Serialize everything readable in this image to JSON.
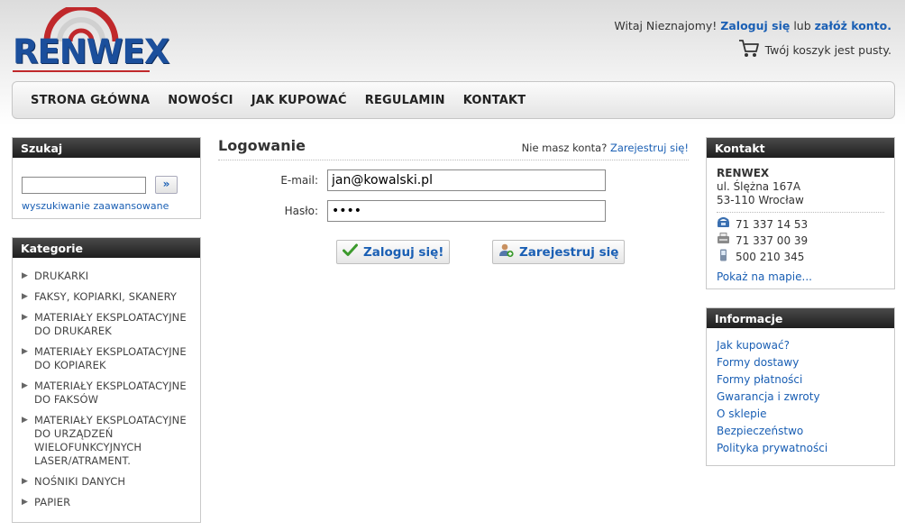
{
  "brand": {
    "logo_text": "RENWEX",
    "color_primary": "#1b4f9c",
    "color_accent": "#c0282b"
  },
  "header": {
    "greeting": "Witaj Nieznajomy!",
    "login_link": "Zaloguj się",
    "separator": "lub",
    "register_link": "załóż konto.",
    "cart_icon": "shopping-cart-icon",
    "cart_status": "Twój koszyk jest pusty."
  },
  "nav": {
    "items": [
      "STRONA GŁÓWNA",
      "NOWOŚCI",
      "JAK KUPOWAĆ",
      "REGULAMIN",
      "KONTAKT"
    ]
  },
  "search": {
    "title": "Szukaj",
    "value": "",
    "button_label": "»",
    "advanced_link": "wyszukiwanie zaawansowane"
  },
  "categories": {
    "title": "Kategorie",
    "items": [
      "DRUKARKI",
      "FAKSY, KOPIARKI, SKANERY",
      "MATERIAŁY EKSPLOATACYJNE DO DRUKAREK",
      "MATERIAŁY EKSPLOATACYJNE DO KOPIAREK",
      "MATERIAŁY EKSPLOATACYJNE DO FAKSÓW",
      "MATERIAŁY EKSPLOATACYJNE DO URZĄDZEŃ WIELOFUNKCYJNYCH LASER/ATRAMENT.",
      "NOŚNIKI DANYCH",
      "PAPIER"
    ]
  },
  "login": {
    "title": "Logowanie",
    "no_account_text": "Nie masz konta?",
    "register_link": "Zarejestruj się!",
    "email_label": "E-mail:",
    "email_value": "jan@kowalski.pl",
    "password_label": "Hasło:",
    "password_value": "••••",
    "login_button": "Zaloguj się!",
    "register_button": "Zarejestruj się"
  },
  "contact": {
    "title": "Kontakt",
    "company": "RENWEX",
    "street": "ul. Ślężna 167A",
    "city": "53-110 Wrocław",
    "phone": "71 337 14 53",
    "fax": "71 337 00 39",
    "mobile": "500 210 345",
    "map_link": "Pokaż na mapie..."
  },
  "info": {
    "title": "Informacje",
    "items": [
      "Jak kupować?",
      "Formy dostawy",
      "Formy płatności",
      "Gwarancja i zwroty",
      "O sklepie",
      "Bezpieczeństwo",
      "Polityka prywatności"
    ]
  }
}
